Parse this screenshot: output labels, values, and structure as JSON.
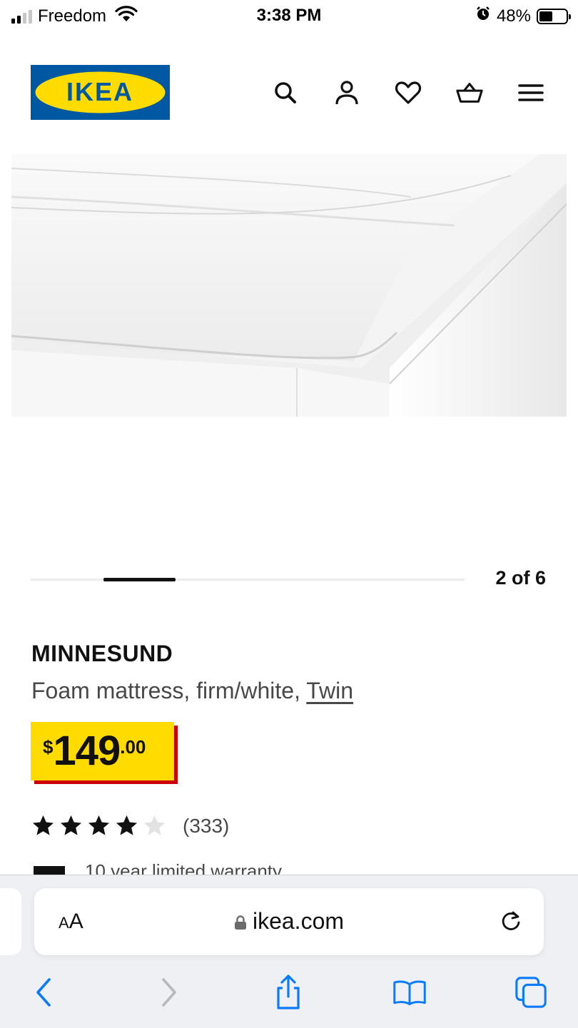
{
  "status_bar": {
    "carrier": "Freedom",
    "time": "3:38 PM",
    "battery": "48%",
    "battery_level": 0.48,
    "signal_bars": 2,
    "icons": [
      "signal-icon",
      "wifi-icon",
      "alarm-icon",
      "battery-icon"
    ]
  },
  "header": {
    "logo_text": "IKEA",
    "icons": [
      "search-icon",
      "account-icon",
      "favorites-heart-icon",
      "shopping-basket-icon",
      "menu-icon"
    ]
  },
  "carousel": {
    "counter": "2 of 6",
    "current_index": 2,
    "total": 6
  },
  "product": {
    "name": "MINNESUND",
    "description_prefix": "Foam mattress, firm/white, ",
    "size_link": "Twin",
    "price": {
      "currency": "$",
      "integer": "149",
      "decimals": ".00"
    },
    "rating": {
      "value": 4,
      "max": 5,
      "review_count": "(333)"
    },
    "peek_text": "10 year limited warranty"
  },
  "browser": {
    "aa_small": "A",
    "aa_big": "A",
    "url": "ikea.com",
    "toolbar": [
      "back-icon",
      "forward-icon",
      "share-icon",
      "bookmarks-icon",
      "tabs-icon"
    ]
  },
  "colors": {
    "ikea_blue": "#0058a3",
    "ikea_yellow": "#ffdb00",
    "price_shadow": "#cc0008",
    "ios_blue": "#0a7aff"
  }
}
